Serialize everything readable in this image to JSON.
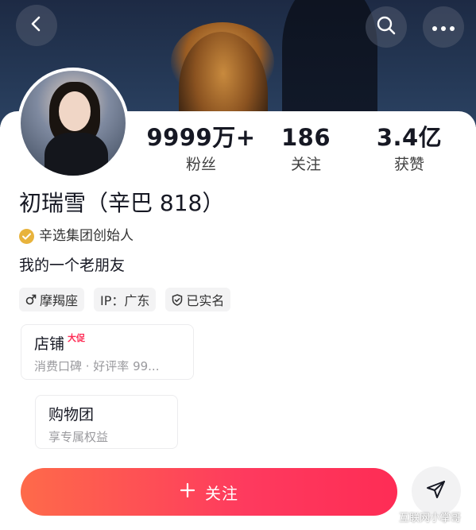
{
  "header": {
    "back_icon": "chevron-left-icon",
    "search_icon": "search-icon",
    "more_icon": "more-horizontal-icon"
  },
  "profile": {
    "name": "初瑞雪（辛巴 818）",
    "verification": "辛选集团创始人",
    "bio": "我的一个老朋友"
  },
  "stats": [
    {
      "value": "9999万+",
      "label": "粉丝"
    },
    {
      "value": "186",
      "label": "关注"
    },
    {
      "value": "3.4亿",
      "label": "获赞"
    }
  ],
  "tags": [
    {
      "icon": "male-icon",
      "label": "摩羯座"
    },
    {
      "icon": "",
      "label": "IP：广东"
    },
    {
      "icon": "shield-check-icon",
      "label": "已实名"
    }
  ],
  "cards": {
    "shop": {
      "title": "店铺",
      "badge": "大促",
      "subtitle": "消费口碑 · 好评率 99..."
    },
    "group": {
      "title": "购物团",
      "subtitle": "享专属权益"
    }
  },
  "actions": {
    "follow_label": "关注",
    "share_icon": "send-icon"
  },
  "watermark": "互联网小掌哥",
  "colors": {
    "accent": "#fe2c55",
    "verify_badge": "#e8b33c"
  }
}
